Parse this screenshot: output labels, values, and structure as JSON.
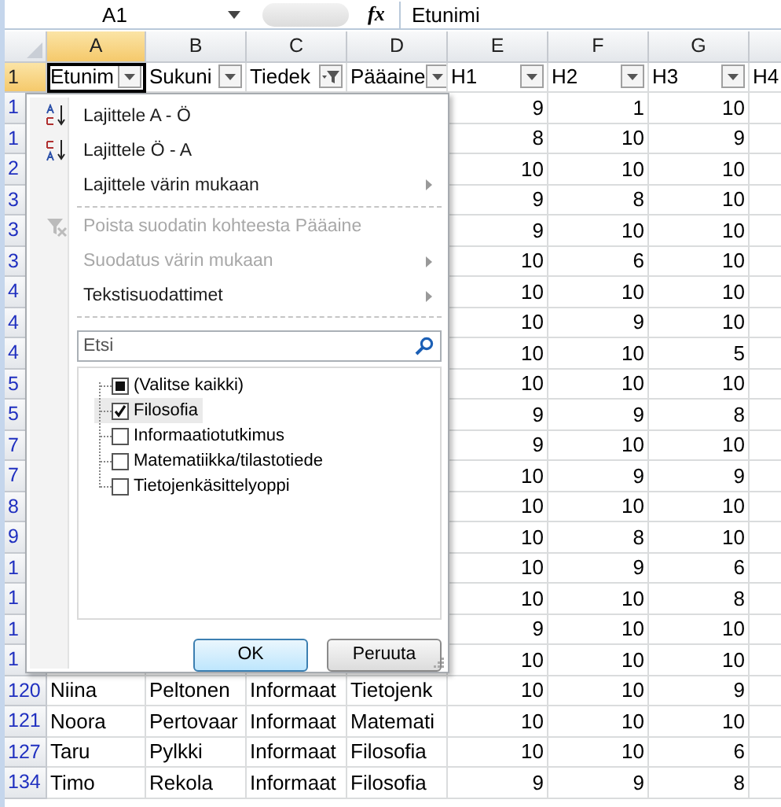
{
  "formula_bar": {
    "name_box": "A1",
    "fx": "fx",
    "value": "Etunimi"
  },
  "columns": [
    {
      "letter": "A",
      "selected": true
    },
    {
      "letter": "B",
      "selected": false
    },
    {
      "letter": "C",
      "selected": false
    },
    {
      "letter": "D",
      "selected": false
    },
    {
      "letter": "E",
      "selected": false
    },
    {
      "letter": "F",
      "selected": false
    },
    {
      "letter": "G",
      "selected": false
    },
    {
      "selected": false
    }
  ],
  "header_row": {
    "number": "1",
    "cells": [
      {
        "text": "Etunim",
        "kind": "dropdown"
      },
      {
        "text": "Sukuni",
        "kind": "dropdown"
      },
      {
        "text": "Tiedek",
        "kind": "filtered"
      },
      {
        "text": "Pääaine",
        "kind": "dropdown"
      },
      {
        "text": "H1",
        "kind": "dropdown"
      },
      {
        "text": "H2",
        "kind": "dropdown"
      },
      {
        "text": "H3",
        "kind": "dropdown"
      },
      {
        "text": "H4",
        "kind": "plain"
      }
    ]
  },
  "rows": [
    {
      "number": "1",
      "values": [
        "9",
        "1",
        "10"
      ]
    },
    {
      "number": "1",
      "values": [
        "8",
        "10",
        "9"
      ]
    },
    {
      "number": "2",
      "values": [
        "10",
        "10",
        "10"
      ]
    },
    {
      "number": "3",
      "values": [
        "9",
        "8",
        "10"
      ]
    },
    {
      "number": "3",
      "values": [
        "9",
        "10",
        "10"
      ]
    },
    {
      "number": "3",
      "values": [
        "10",
        "6",
        "10"
      ]
    },
    {
      "number": "4",
      "values": [
        "10",
        "10",
        "10"
      ]
    },
    {
      "number": "4",
      "values": [
        "10",
        "9",
        "10"
      ]
    },
    {
      "number": "4",
      "values": [
        "10",
        "10",
        "5"
      ]
    },
    {
      "number": "5",
      "values": [
        "10",
        "10",
        "10"
      ]
    },
    {
      "number": "5",
      "values": [
        "9",
        "9",
        "8"
      ]
    },
    {
      "number": "7",
      "values": [
        "9",
        "10",
        "10"
      ]
    },
    {
      "number": "7",
      "values": [
        "10",
        "9",
        "9"
      ]
    },
    {
      "number": "8",
      "values": [
        "10",
        "10",
        "10"
      ]
    },
    {
      "number": "9",
      "values": [
        "10",
        "8",
        "10"
      ]
    },
    {
      "number": "1",
      "values": [
        "10",
        "9",
        "6"
      ]
    },
    {
      "number": "1",
      "values": [
        "10",
        "10",
        "8"
      ]
    },
    {
      "number": "1",
      "values": [
        "9",
        "10",
        "10"
      ]
    },
    {
      "number": "1",
      "values": [
        "10",
        "10",
        "10"
      ]
    },
    {
      "number": "120",
      "names": [
        "Niina",
        "Peltonen",
        "Informaat",
        "Tietojenk"
      ],
      "values": [
        "10",
        "10",
        "9"
      ]
    },
    {
      "number": "121",
      "names": [
        "Noora",
        "Pertovaar",
        "Informaat",
        "Matemati"
      ],
      "values": [
        "10",
        "10",
        "10"
      ]
    },
    {
      "number": "127",
      "names": [
        "Taru",
        "Pylkki",
        "Informaat",
        "Filosofia"
      ],
      "values": [
        "10",
        "10",
        "6"
      ]
    },
    {
      "number": "134",
      "names": [
        "Timo",
        "Rekola",
        "Informaat",
        "Filosofia"
      ],
      "values": [
        "9",
        "9",
        "8"
      ]
    }
  ],
  "filter_menu": {
    "items": [
      {
        "label": "Lajittele A - Ö",
        "kind": "sortup",
        "disabled": false,
        "submenu": false
      },
      {
        "label": "Lajittele Ö - A",
        "kind": "sortdown",
        "disabled": false,
        "submenu": false
      },
      {
        "label": "Lajittele värin mukaan",
        "kind": "plain",
        "disabled": false,
        "submenu": true,
        "separator_after": true
      },
      {
        "label": "Poista suodatin kohteesta Pääaine",
        "kind": "clear",
        "disabled": true,
        "submenu": false
      },
      {
        "label": "Suodatus värin mukaan",
        "kind": "plain",
        "disabled": true,
        "submenu": true
      },
      {
        "label": "Tekstisuodattimet",
        "kind": "plain",
        "disabled": false,
        "submenu": true,
        "separator_after": true
      }
    ],
    "search": {
      "placeholder": "Etsi"
    },
    "values": [
      {
        "label": "(Valitse kaikki)",
        "checked": false,
        "indeterminate": true,
        "selected": false
      },
      {
        "label": "Filosofia",
        "checked": true,
        "indeterminate": false,
        "selected": true
      },
      {
        "label": "Informaatiotutkimus",
        "checked": false,
        "indeterminate": false,
        "selected": false
      },
      {
        "label": "Matematiikka/tilastotiede",
        "checked": false,
        "indeterminate": false,
        "selected": false
      },
      {
        "label": "Tietojenkäsittelyoppi",
        "checked": false,
        "indeterminate": false,
        "selected": false
      }
    ],
    "buttons": [
      {
        "label": "OK",
        "default": true
      },
      {
        "label": "Peruuta",
        "default": false
      }
    ]
  }
}
